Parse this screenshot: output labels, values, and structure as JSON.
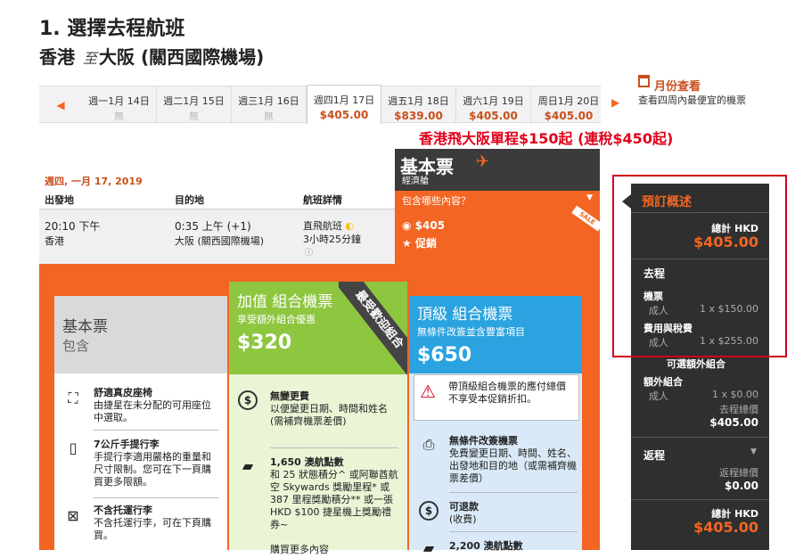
{
  "header": {
    "step_title": "1. 選擇去程航班",
    "route_from": "香港",
    "route_to_sep": "至",
    "route_to": "大阪 (關西國際機場)"
  },
  "date_nav": {
    "prev_icon": "left-arrow-icon",
    "next_icon": "right-arrow-icon",
    "tabs": [
      {
        "label": "週一1月 14日",
        "price": "",
        "unavailable": "無"
      },
      {
        "label": "週二1月 15日",
        "price": "",
        "unavailable": "無"
      },
      {
        "label": "週三1月 16日",
        "price": "",
        "unavailable": "無"
      },
      {
        "label": "週四1月 17日",
        "price": "$405.00",
        "unavailable": ""
      },
      {
        "label": "週五1月 18日",
        "price": "$839.00",
        "unavailable": ""
      },
      {
        "label": "週六1月 19日",
        "price": "$405.00",
        "unavailable": ""
      },
      {
        "label": "周日1月 20日",
        "price": "$405.00",
        "unavailable": ""
      }
    ],
    "selected_index": 3,
    "month_link": "月份查看",
    "month_sub": "查看四周內最便宜的機票"
  },
  "promo": "香港飛大阪單程$150起 (連稅$450起)",
  "fare_header": {
    "title": "基本票",
    "subtitle": "經濟艙",
    "included": "包含哪些內容？"
  },
  "flight": {
    "date": "週四, 一月 17, 2019",
    "headers": {
      "origin": "出發地",
      "dest": "目的地",
      "details": "航班詳情"
    },
    "dep_time": "20:10 下午",
    "dep_city": "香港",
    "arr_time": "0:35 上午 (+1)",
    "arr_city": "大阪 (關西國際機場)",
    "type": "直飛航班",
    "duration": "3小時25分鐘",
    "fare_price": "$405",
    "fare_tag": "促銷",
    "sale": "SALE"
  },
  "packages": {
    "basic": {
      "name": "基本票",
      "desc": "包含",
      "features": [
        {
          "title": "舒適真皮座椅",
          "text": "由捷星在未分配的可用座位中選取。"
        },
        {
          "title": "7公斤手提行李",
          "text": "手提行李適用嚴格的重量和尺寸限制。您可在下一頁購買更多限額。"
        },
        {
          "title": "不含托運行李",
          "text": "不含托運行李，可在下頁購買。"
        }
      ]
    },
    "plus": {
      "name": "加值 組合機票",
      "desc": "享受額外組合優惠",
      "price": "$320",
      "ribbon": "最受歡迎組合",
      "features": [
        {
          "title": "無變更費",
          "text": "以便變更日期、時間和姓名 (需補齊機票差價)"
        },
        {
          "title": "1,650 澳航點數",
          "text": "和 25 狀態積分^ 或阿聯酋航空 Skywards 獎勵里程* 或 387 里程獎勵積分** 或一張 HKD $100 捷星機上獎勵禮券~"
        },
        {
          "title": "",
          "text": "購買更多內容"
        }
      ]
    },
    "max": {
      "name": "頂級 組合機票",
      "desc": "無條件改簽並含豐富項目",
      "price": "$650",
      "warning": "帶頂級組合機票的應付總價不享受本促銷折扣。",
      "features": [
        {
          "title": "無條件改簽機票",
          "text": "免費變更日期、時間、姓名、出發地和目的地（或需補齊機票差價）"
        },
        {
          "title": "可退款",
          "text": "(收費)"
        },
        {
          "title": "2,200 澳航點數",
          "text": ""
        }
      ]
    }
  },
  "summary": {
    "title": "預訂概述",
    "total_label": "總計 HKD",
    "total": "$405.00",
    "outbound": "去程",
    "ticket": "機票",
    "adult": "成人",
    "ticket_amt": "1 x $150.00",
    "fees": "費用與稅費",
    "fees_amt": "1 x $255.00",
    "extras_title": "可選額外組合",
    "extras": "額外組合",
    "extras_amt": "1 x $0.00",
    "out_total_label": "去程總價",
    "out_total": "$405.00",
    "return": "返程",
    "return_total_label": "返程總價",
    "return_total": "$0.00",
    "grand_label": "總計 HKD",
    "grand_total": "$405.00"
  },
  "colors": {
    "accent": "#f26522",
    "plus": "#8ec640",
    "max": "#2aa3e0",
    "dark": "#2f2f2f"
  }
}
